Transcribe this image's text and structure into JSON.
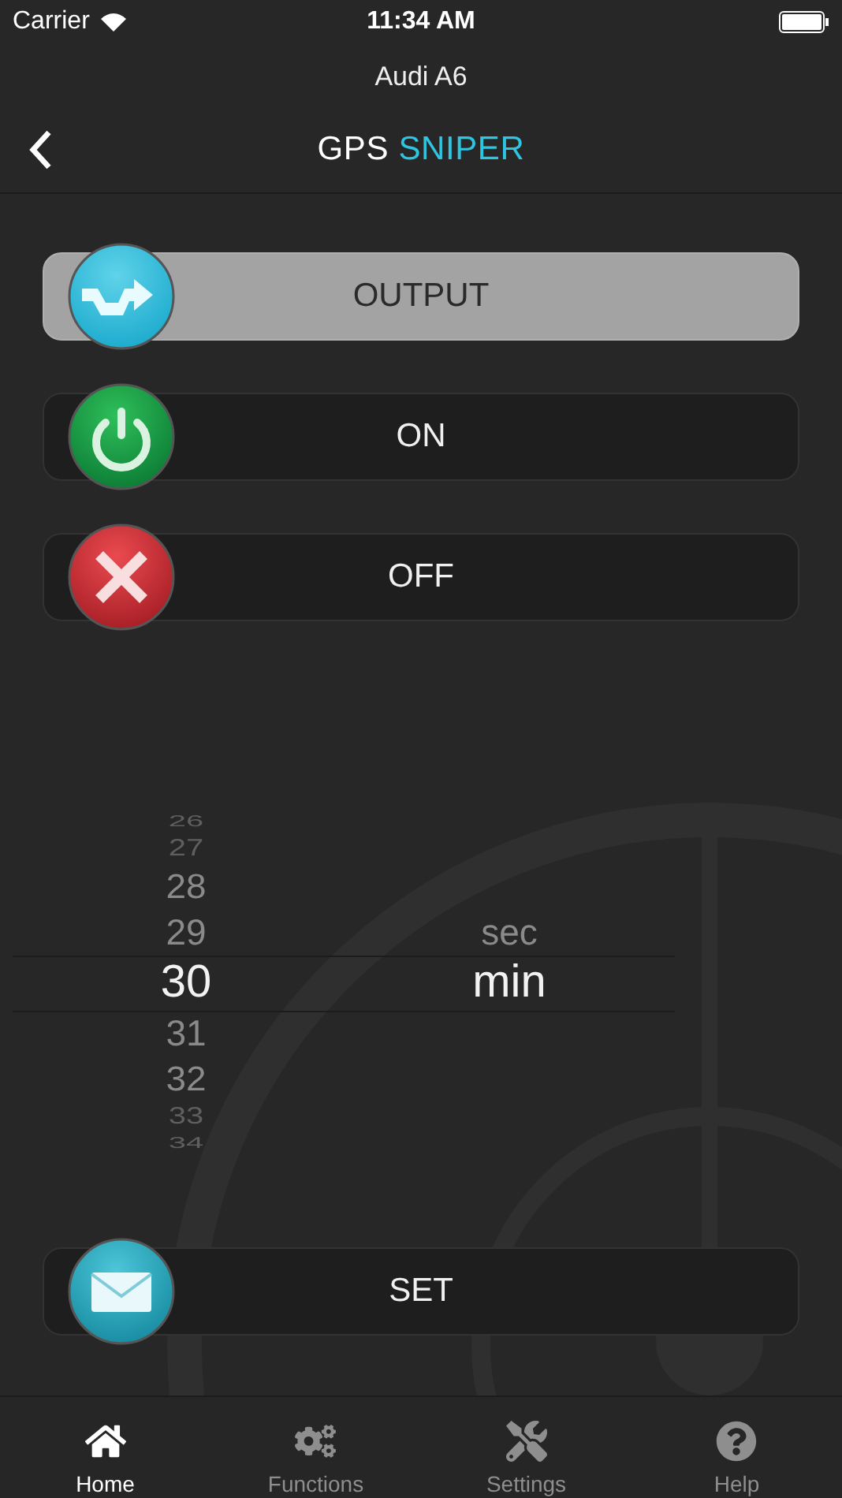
{
  "status_bar": {
    "carrier": "Carrier",
    "time": "11:34 AM"
  },
  "subtitle": "Audi A6",
  "nav": {
    "title": [
      {
        "text": "GPS",
        "accent": false
      },
      {
        "text": "SNIPER",
        "accent": true
      }
    ]
  },
  "actions": [
    {
      "label": "OUTPUT",
      "kind": "output",
      "selected": true
    },
    {
      "label": "ON",
      "kind": "power",
      "selected": false
    },
    {
      "label": "OFF",
      "kind": "cancel",
      "selected": false
    }
  ],
  "picker": {
    "numbers": [
      {
        "label": "26",
        "selected": false
      },
      {
        "label": "27",
        "selected": false
      },
      {
        "label": "28",
        "selected": false
      },
      {
        "label": "29",
        "selected": false
      },
      {
        "label": "30",
        "selected": true
      },
      {
        "label": "31",
        "selected": false
      },
      {
        "label": "32",
        "selected": false
      },
      {
        "label": "33",
        "selected": false
      },
      {
        "label": "34",
        "selected": false
      }
    ],
    "units": [
      {
        "label": "sec",
        "selected": false
      },
      {
        "label": "min",
        "selected": true
      }
    ]
  },
  "set_button": {
    "label": "SET",
    "kind": "mail",
    "selected": false
  },
  "tabs": [
    {
      "label": "Home",
      "kind": "home",
      "selected": true
    },
    {
      "label": "Functions",
      "kind": "gears",
      "selected": false
    },
    {
      "label": "Settings",
      "kind": "tools",
      "selected": false
    },
    {
      "label": "Help",
      "kind": "help",
      "selected": false
    }
  ]
}
